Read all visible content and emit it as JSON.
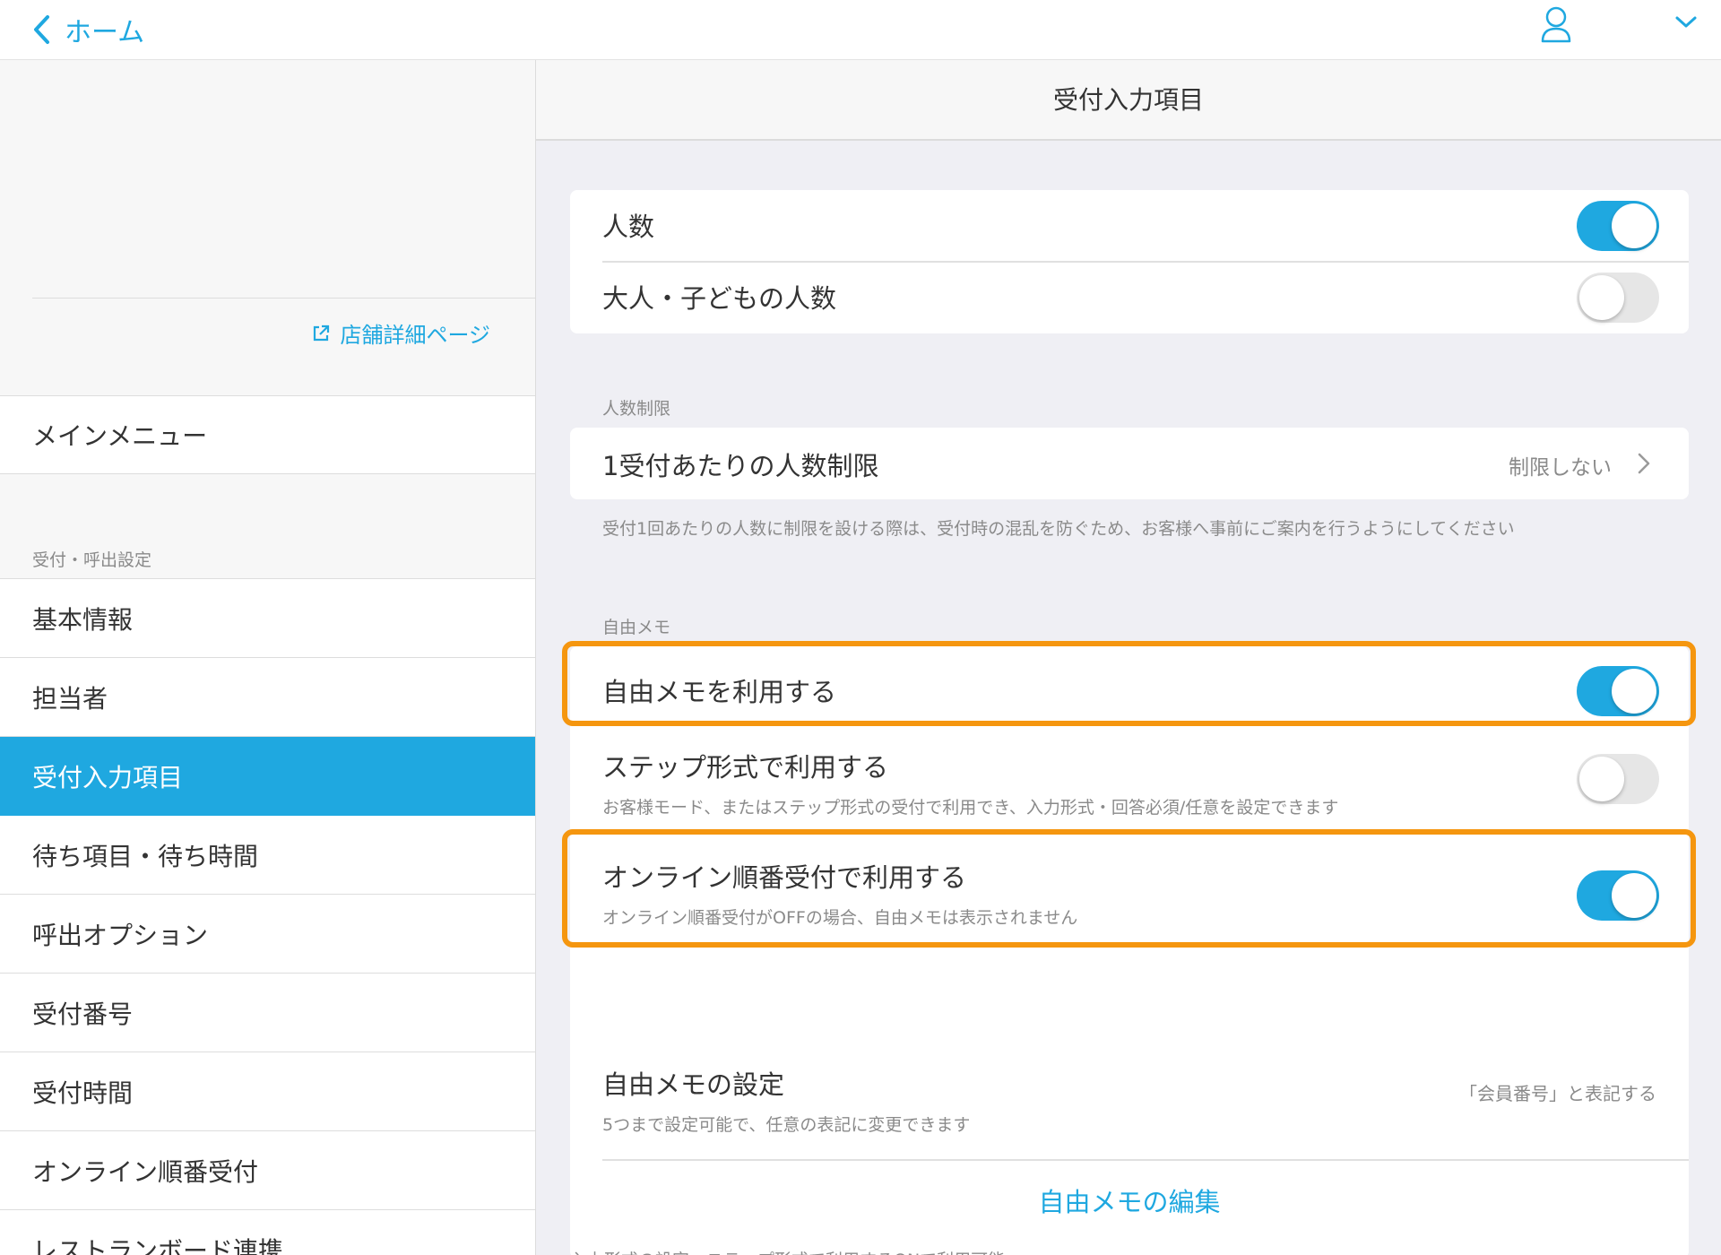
{
  "topbar": {
    "back_label": "ホーム"
  },
  "sidebar": {
    "store_link_label": "店舗詳細ページ",
    "main_menu_label": "メインメニュー",
    "section_label": "受付・呼出設定",
    "items": [
      {
        "label": "基本情報"
      },
      {
        "label": "担当者"
      },
      {
        "label": "受付入力項目"
      },
      {
        "label": "待ち項目・待ち時間"
      },
      {
        "label": "呼出オプション"
      },
      {
        "label": "受付番号"
      },
      {
        "label": "受付時間"
      },
      {
        "label": "オンライン順番受付"
      },
      {
        "label": "レストランボード連携"
      }
    ],
    "active_item": "受付入力項目"
  },
  "content": {
    "title": "受付入力項目",
    "people": {
      "label": "人数",
      "on": true
    },
    "adult_child": {
      "label": "大人・子どもの人数",
      "on": false
    },
    "limit_section": "人数制限",
    "limit_row": {
      "label": "1受付あたりの人数制限",
      "value": "制限しない"
    },
    "limit_note": "受付1回あたりの人数に制限を設ける際は、受付時の混乱を防ぐため、お客様へ事前にご案内を行うようにしてください",
    "memo_section": "自由メモ",
    "use_memo": {
      "label": "自由メモを利用する",
      "on": true
    },
    "step_format": {
      "label": "ステップ形式で利用する",
      "sub": "お客様モード、またはステップ形式の受付で利用でき、入力形式・回答必須/任意を設定できます",
      "on": false
    },
    "online": {
      "label": "オンライン順番受付で利用する",
      "sub": "オンライン順番受付がOFFの場合、自由メモは表示されません",
      "on": true
    },
    "memo_settings": {
      "label": "自由メモの設定",
      "sub": "5つまで設定可能で、任意の表記に変更できます",
      "value": "「会員番号」と表記する"
    },
    "edit_memo": "自由メモの編集",
    "bottom_note": "入力形式の設定：ステップ形式で利用するONで利用可能"
  },
  "colors": {
    "accent": "#1fa8e0",
    "highlight": "#f5960f"
  }
}
